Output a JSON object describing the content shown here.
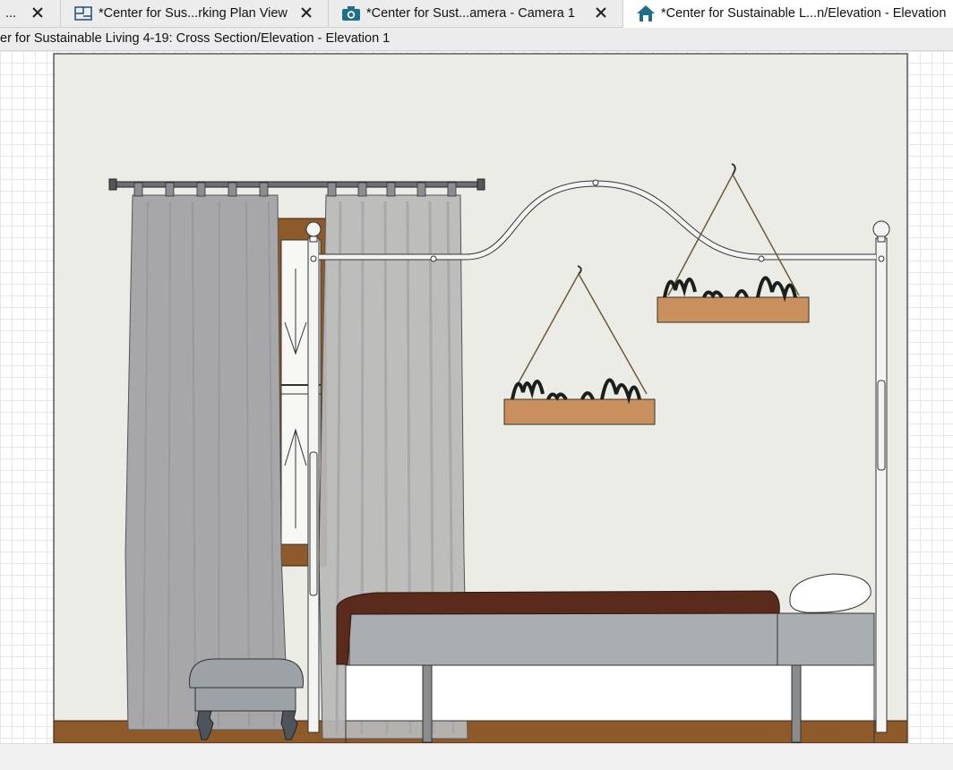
{
  "tabs": [
    {
      "label": "...",
      "icon": "overflow-tab",
      "active": false
    },
    {
      "label": "*Center for Sus...rking Plan View",
      "icon": "plan-view-icon",
      "active": false
    },
    {
      "label": "*Center for Sust...amera - Camera 1",
      "icon": "camera-icon",
      "active": false
    },
    {
      "label": "*Center for Sustainable L...n/Elevation - Elevation",
      "icon": "house-icon",
      "active": true
    }
  ],
  "view_title": "er for Sustainable Living 4-19: Cross Section/Elevation - Elevation 1",
  "colors": {
    "wall": "#ecece6",
    "floor_trim": "#8f5a2a",
    "curtain": "#a7a7a9",
    "bed_frame": "#f4f4f2",
    "blanket": "#5a2a1c",
    "mattress": "#a9aeb1",
    "planter": "#c98f5d",
    "tab_active_icon": "#1f6f8b"
  }
}
